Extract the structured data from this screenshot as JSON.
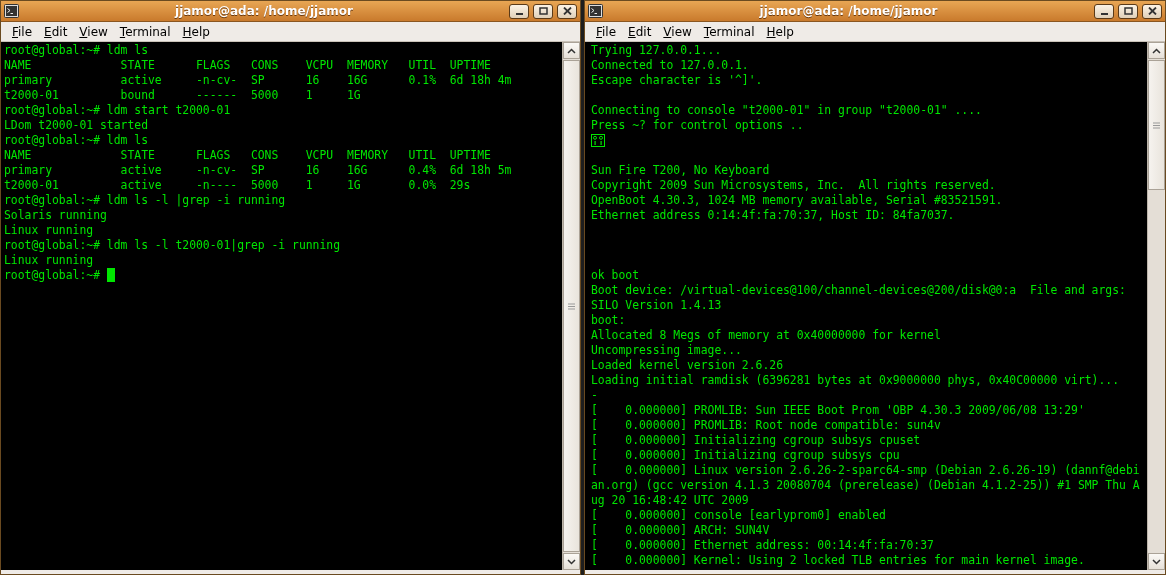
{
  "windows": [
    {
      "title": "jjamor@ada: /home/jjamor",
      "menu": [
        "File",
        "Edit",
        "View",
        "Terminal",
        "Help"
      ],
      "scrolled": false,
      "lines": [
        {
          "kind": "text",
          "text": "root@global:~# ldm ls"
        },
        {
          "kind": "text",
          "text": "NAME             STATE      FLAGS   CONS    VCPU  MEMORY   UTIL  UPTIME"
        },
        {
          "kind": "text",
          "text": "primary          active     -n-cv-  SP      16    16G      0.1%  6d 18h 4m"
        },
        {
          "kind": "text",
          "text": "t2000-01         bound      ------  5000    1     1G"
        },
        {
          "kind": "text",
          "text": "root@global:~# ldm start t2000-01"
        },
        {
          "kind": "text",
          "text": "LDom t2000-01 started"
        },
        {
          "kind": "text",
          "text": "root@global:~# ldm ls"
        },
        {
          "kind": "text",
          "text": "NAME             STATE      FLAGS   CONS    VCPU  MEMORY   UTIL  UPTIME"
        },
        {
          "kind": "text",
          "text": "primary          active     -n-cv-  SP      16    16G      0.4%  6d 18h 5m"
        },
        {
          "kind": "text",
          "text": "t2000-01         active     -n----  5000    1     1G       0.0%  29s"
        },
        {
          "kind": "text",
          "text": "root@global:~# ldm ls -l |grep -i running"
        },
        {
          "kind": "text",
          "text": "Solaris running"
        },
        {
          "kind": "text",
          "text": "Linux running"
        },
        {
          "kind": "text",
          "text": "root@global:~# ldm ls -l t2000-01|grep -i running"
        },
        {
          "kind": "text",
          "text": "Linux running"
        },
        {
          "kind": "cursor",
          "text": "root@global:~# "
        }
      ]
    },
    {
      "title": "jjamor@ada: /home/jjamor",
      "menu": [
        "File",
        "Edit",
        "View",
        "Terminal",
        "Help"
      ],
      "scrolled": true,
      "lines": [
        {
          "kind": "text",
          "text": "Trying 127.0.0.1..."
        },
        {
          "kind": "text",
          "text": "Connected to 127.0.0.1."
        },
        {
          "kind": "text",
          "text": "Escape character is '^]'."
        },
        {
          "kind": "blank"
        },
        {
          "kind": "text",
          "text": "Connecting to console \"t2000-01\" in group \"t2000-01\" ...."
        },
        {
          "kind": "text",
          "text": "Press ~? for control options .."
        },
        {
          "kind": "glyph"
        },
        {
          "kind": "blank"
        },
        {
          "kind": "text",
          "text": "Sun Fire T200, No Keyboard"
        },
        {
          "kind": "text",
          "text": "Copyright 2009 Sun Microsystems, Inc.  All rights reserved."
        },
        {
          "kind": "text",
          "text": "OpenBoot 4.30.3, 1024 MB memory available, Serial #83521591."
        },
        {
          "kind": "text",
          "text": "Ethernet address 0:14:4f:fa:70:37, Host ID: 84fa7037."
        },
        {
          "kind": "blank"
        },
        {
          "kind": "blank"
        },
        {
          "kind": "blank"
        },
        {
          "kind": "text",
          "text": "ok boot"
        },
        {
          "kind": "text",
          "text": "Boot device: /virtual-devices@100/channel-devices@200/disk@0:a  File and args:"
        },
        {
          "kind": "text",
          "text": "SILO Version 1.4.13"
        },
        {
          "kind": "text",
          "text": "boot:"
        },
        {
          "kind": "text",
          "text": "Allocated 8 Megs of memory at 0x40000000 for kernel"
        },
        {
          "kind": "text",
          "text": "Uncompressing image..."
        },
        {
          "kind": "text",
          "text": "Loaded kernel version 2.6.26"
        },
        {
          "kind": "text",
          "text": "Loading initial ramdisk (6396281 bytes at 0x9000000 phys, 0x40C00000 virt)..."
        },
        {
          "kind": "text",
          "text": "-"
        },
        {
          "kind": "text",
          "text": "[    0.000000] PROMLIB: Sun IEEE Boot Prom 'OBP 4.30.3 2009/06/08 13:29'"
        },
        {
          "kind": "text",
          "text": "[    0.000000] PROMLIB: Root node compatible: sun4v"
        },
        {
          "kind": "text",
          "text": "[    0.000000] Initializing cgroup subsys cpuset"
        },
        {
          "kind": "text",
          "text": "[    0.000000] Initializing cgroup subsys cpu"
        },
        {
          "kind": "text",
          "text": "[    0.000000] Linux version 2.6.26-2-sparc64-smp (Debian 2.6.26-19) (dannf@debi"
        },
        {
          "kind": "text",
          "text": "an.org) (gcc version 4.1.3 20080704 (prerelease) (Debian 4.1.2-25)) #1 SMP Thu A"
        },
        {
          "kind": "text",
          "text": "ug 20 16:48:42 UTC 2009"
        },
        {
          "kind": "text",
          "text": "[    0.000000] console [earlyprom0] enabled"
        },
        {
          "kind": "text",
          "text": "[    0.000000] ARCH: SUN4V"
        },
        {
          "kind": "text",
          "text": "[    0.000000] Ethernet address: 00:14:4f:fa:70:37"
        },
        {
          "kind": "text",
          "text": "[    0.000000] Kernel: Using 2 locked TLB entries for main kernel image."
        }
      ]
    }
  ]
}
